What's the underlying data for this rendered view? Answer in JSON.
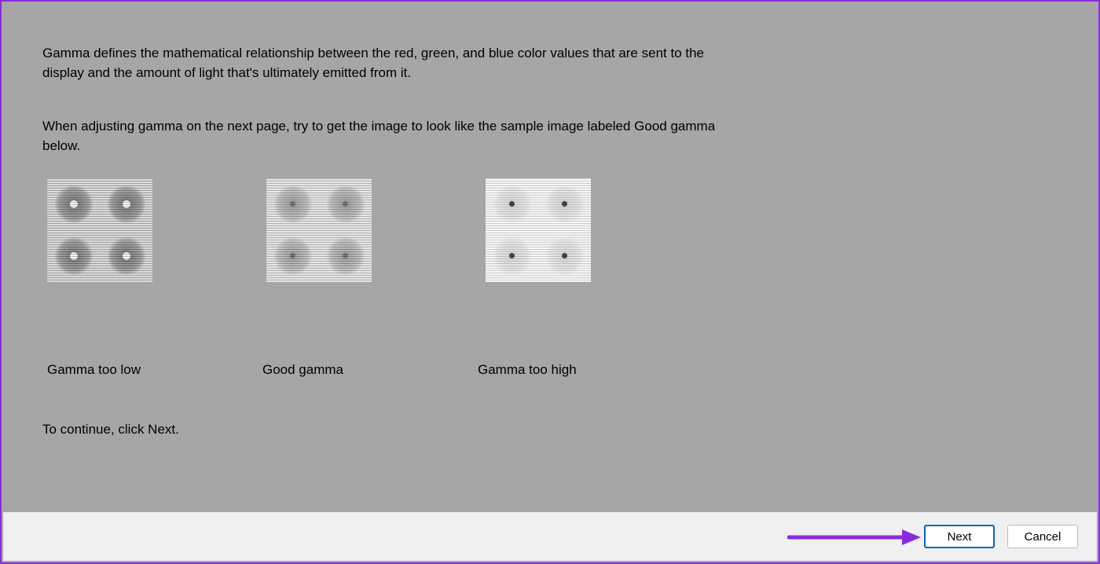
{
  "accent_purple": "#8a2be2",
  "intro": "Gamma defines the mathematical relationship between the red, green, and blue color values that are sent to the display and the amount of light that's ultimately emitted from it.",
  "instruction": "When adjusting gamma on the next page, try to get the image to look like the sample image labeled Good gamma below.",
  "samples": {
    "low": {
      "label": "Gamma too low"
    },
    "good": {
      "label": "Good gamma"
    },
    "high": {
      "label": "Gamma too high"
    }
  },
  "continue_hint": "To continue, click Next.",
  "buttons": {
    "next": "Next",
    "cancel": "Cancel"
  }
}
